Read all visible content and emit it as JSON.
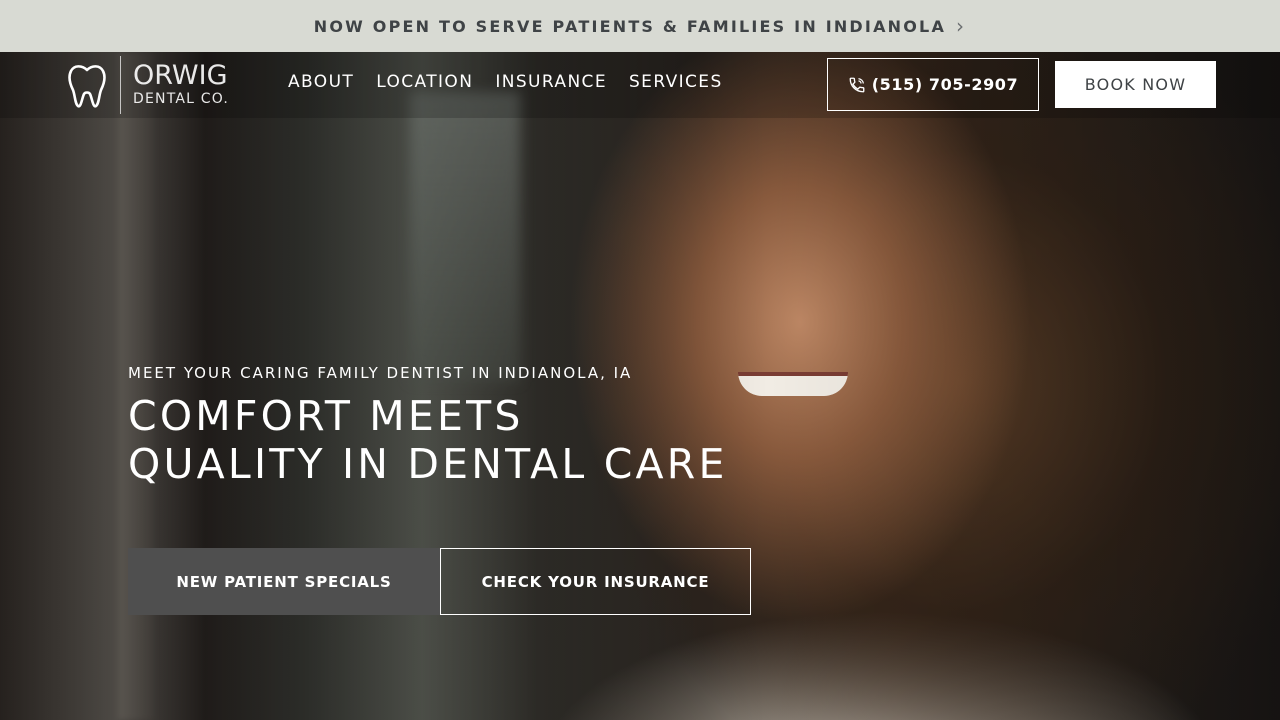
{
  "announcement": {
    "text": "NOW OPEN TO SERVE PATIENTS & FAMILIES IN INDIANOLA",
    "arrow_icon": "chevron-right-icon"
  },
  "logo": {
    "line1": "ORWIG",
    "line2": "DENTAL CO.",
    "icon": "tooth-icon"
  },
  "nav": {
    "items": [
      "ABOUT",
      "LOCATION",
      "INSURANCE",
      "SERVICES"
    ]
  },
  "header": {
    "phone_label": "(515) 705-2907",
    "phone_icon": "phone-icon",
    "book_label": "BOOK NOW"
  },
  "hero": {
    "eyebrow": "MEET YOUR CARING FAMILY DENTIST IN INDIANOLA, IA",
    "headline_line1": "COMFORT MEETS",
    "headline_line2": "QUALITY IN DENTAL CARE",
    "primary_cta": "NEW PATIENT SPECIALS",
    "secondary_cta": "CHECK YOUR INSURANCE"
  },
  "colors": {
    "announce_bg": "#d8dad3",
    "announce_text": "#3f4346",
    "primary_cta_bg": "#4f4f4f",
    "book_bg": "#ffffff"
  }
}
